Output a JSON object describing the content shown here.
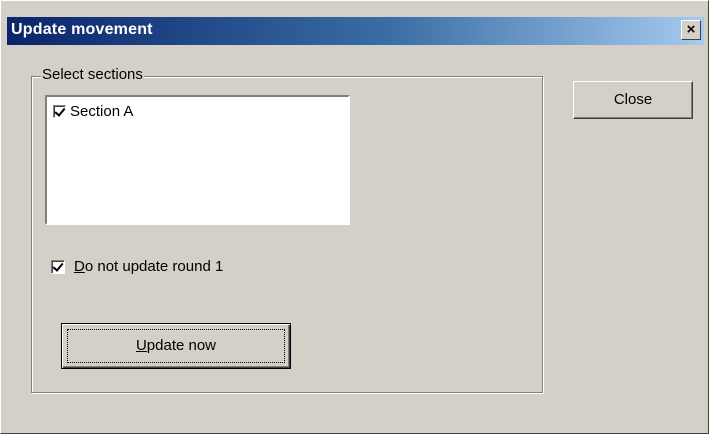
{
  "window": {
    "title": "Update movement",
    "close_glyph": "×"
  },
  "group": {
    "legend": "Select sections",
    "sections": [
      {
        "label": "Section A",
        "checked": true
      }
    ]
  },
  "options": {
    "no_update_round1": {
      "mnemonic": "D",
      "rest": "o not update round 1",
      "checked": true
    }
  },
  "buttons": {
    "close_label": "Close",
    "update_mnemonic": "U",
    "update_rest": "pdate now"
  },
  "icons": {
    "window_close": "close-icon",
    "checkbox_checked": "check-icon"
  },
  "colors": {
    "face": "#d4d0c8",
    "title_start": "#0a246a",
    "title_end": "#a6caf0"
  }
}
